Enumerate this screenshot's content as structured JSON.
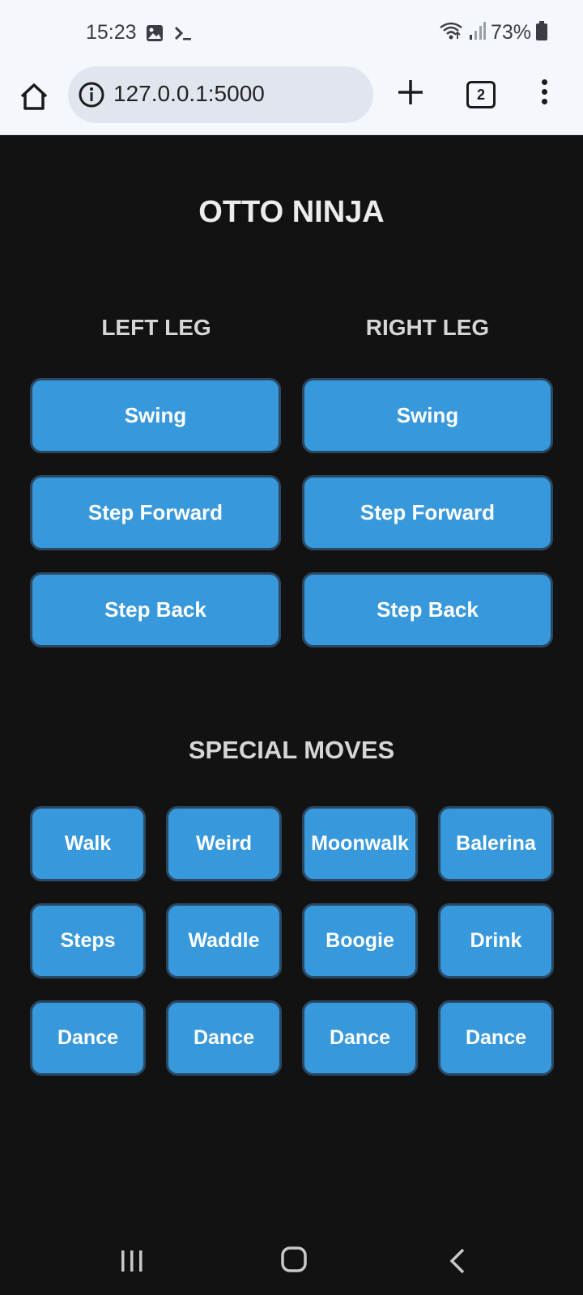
{
  "status_bar": {
    "time": "15:23",
    "battery": "73%",
    "icons": [
      "gallery-icon",
      "terminal-icon",
      "wifi-icon",
      "signal-icon",
      "battery-icon"
    ]
  },
  "browser": {
    "url": "127.0.0.1:5000",
    "tab_count": "2"
  },
  "page": {
    "title": "OTTO NINJA",
    "left_leg": {
      "header": "LEFT LEG",
      "buttons": [
        "Swing",
        "Step Forward",
        "Step Back"
      ]
    },
    "right_leg": {
      "header": "RIGHT LEG",
      "buttons": [
        "Swing",
        "Step Forward",
        "Step Back"
      ]
    },
    "special_moves": {
      "header": "SPECIAL MOVES",
      "buttons": [
        "Walk",
        "Weird",
        "Moonwalk",
        "Balerina",
        "Steps",
        "Waddle",
        "Boogie",
        "Drink",
        "Dance",
        "Dance",
        "Dance",
        "Dance"
      ]
    }
  },
  "colors": {
    "background": "#121212",
    "button": "#3798dc",
    "button_border": "#2a4863",
    "chrome": "#f4f8fc"
  }
}
